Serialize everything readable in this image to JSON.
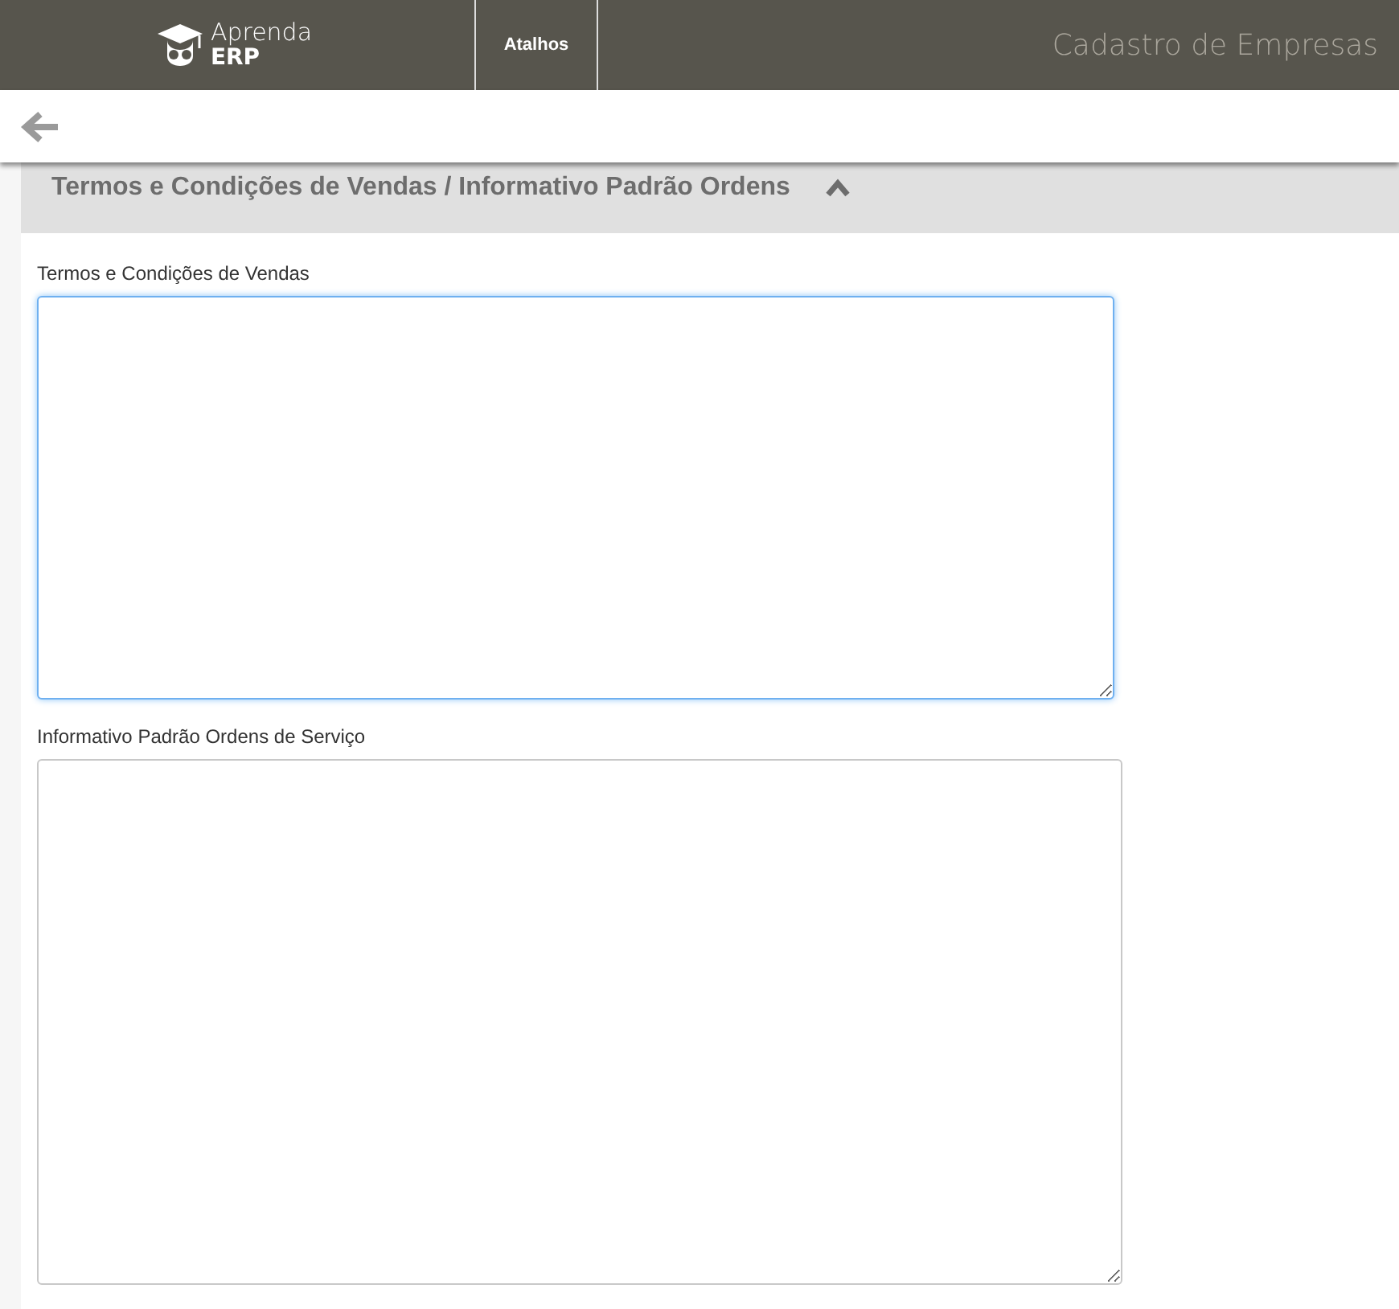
{
  "header": {
    "logo": {
      "line1": "Aprenda",
      "line2": "ERP"
    },
    "nav": [
      {
        "label": "Atalhos"
      }
    ],
    "page_title": "Cadastro de Empresas"
  },
  "section": {
    "title": "Termos e Condições de Vendas / Informativo Padrão Ordens",
    "expanded": true
  },
  "fields": [
    {
      "label": "Termos e Condições de Vendas",
      "focused": true
    },
    {
      "label": "Informativo Padrão Ordens de Serviço",
      "focused": false
    }
  ]
}
